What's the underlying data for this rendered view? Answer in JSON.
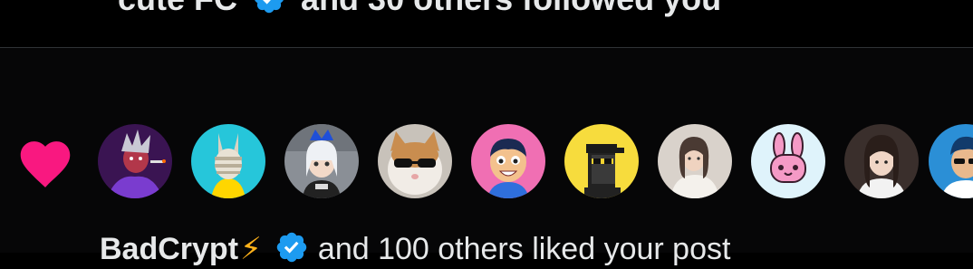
{
  "top_notification": {
    "text": "and 30 others followed you",
    "icon": "verified-badge-icon"
  },
  "like_notification": {
    "icon": "heart-icon",
    "icon_color": "#f91880",
    "avatars": [
      {
        "name": "avatar-1",
        "description": "dark purple character"
      },
      {
        "name": "avatar-2",
        "description": "bandaged bunny on cyan"
      },
      {
        "name": "avatar-3",
        "description": "blue haired anime character"
      },
      {
        "name": "avatar-4",
        "description": "cat with sunglasses"
      },
      {
        "name": "avatar-5",
        "description": "cartoon boy on pink"
      },
      {
        "name": "avatar-6",
        "description": "pixel punk on yellow"
      },
      {
        "name": "avatar-7",
        "description": "woman portrait"
      },
      {
        "name": "avatar-8",
        "description": "pink bunny on light blue"
      },
      {
        "name": "avatar-9",
        "description": "woman portrait dark"
      },
      {
        "name": "avatar-10",
        "description": "cartoon man on blue"
      }
    ],
    "user_name": "BadCrypt",
    "user_emoji": "⚡",
    "caption_rest": "and 100 others liked your post"
  },
  "colors": {
    "background": "#000000",
    "text": "#e7e9ea",
    "verified_blue": "#1d9bf0",
    "heart_pink": "#f91880",
    "divider": "#2f3336"
  }
}
